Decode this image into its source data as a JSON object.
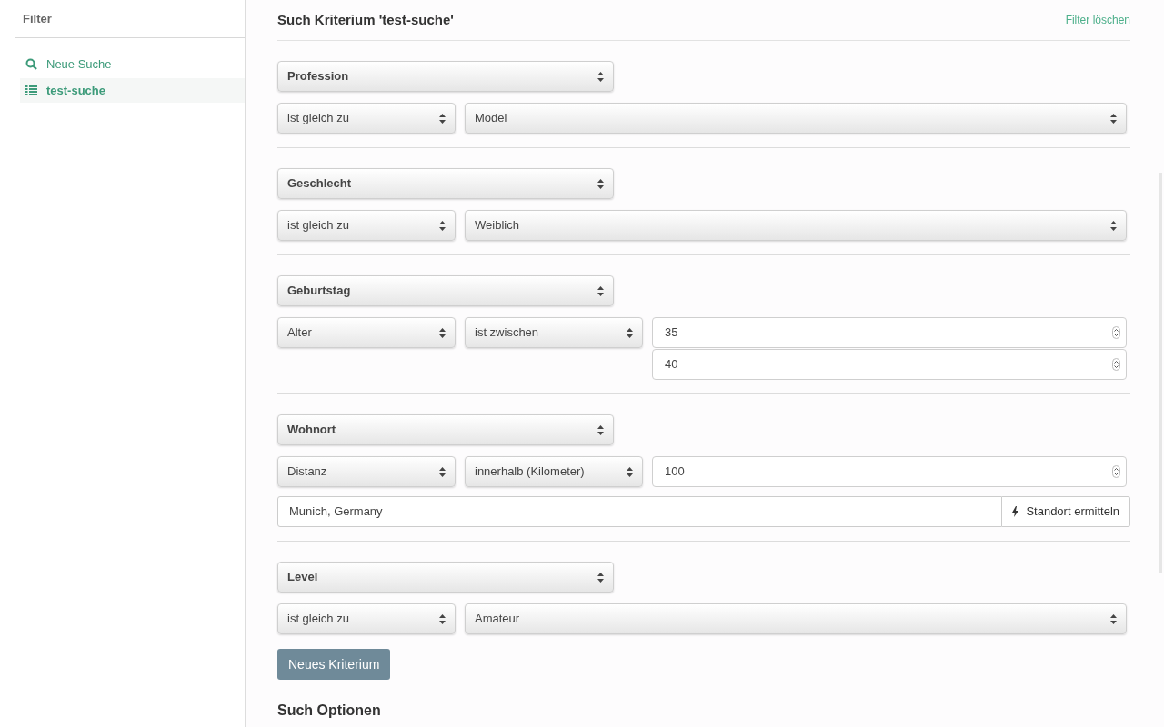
{
  "sidebar": {
    "title": "Filter",
    "items": [
      {
        "label": "Neue Suche",
        "kind": "search",
        "selected": false
      },
      {
        "label": "test-suche",
        "kind": "list",
        "selected": true
      }
    ]
  },
  "header": {
    "title": "Such Kriterium 'test-suche'",
    "clear_link": "Filter löschen"
  },
  "criteria": [
    {
      "field": "Profession",
      "controls": [
        {
          "kind": "select",
          "value": "ist gleich zu"
        },
        {
          "kind": "select-fill",
          "value": "Model"
        }
      ]
    },
    {
      "field": "Geschlecht",
      "controls": [
        {
          "kind": "select",
          "value": "ist gleich zu"
        },
        {
          "kind": "select-fill",
          "value": "Weiblich"
        }
      ]
    },
    {
      "field": "Geburtstag",
      "controls": [
        {
          "kind": "select",
          "value": "Alter"
        },
        {
          "kind": "select",
          "value": "ist zwischen"
        },
        {
          "kind": "number-range",
          "values": [
            "35",
            "40"
          ]
        }
      ]
    },
    {
      "field": "Wohnort",
      "controls": [
        {
          "kind": "select",
          "value": "Distanz"
        },
        {
          "kind": "select",
          "value": "innerhalb (Kilometer)"
        },
        {
          "kind": "number",
          "value": "100"
        }
      ],
      "location": {
        "value": "Munich, Germany",
        "button": "Standort ermitteln"
      }
    },
    {
      "field": "Level",
      "controls": [
        {
          "kind": "select",
          "value": "ist gleich zu"
        },
        {
          "kind": "select-fill",
          "value": "Amateur"
        }
      ]
    }
  ],
  "add_button": "Neues Kriterium",
  "options_title": "Such Optionen"
}
